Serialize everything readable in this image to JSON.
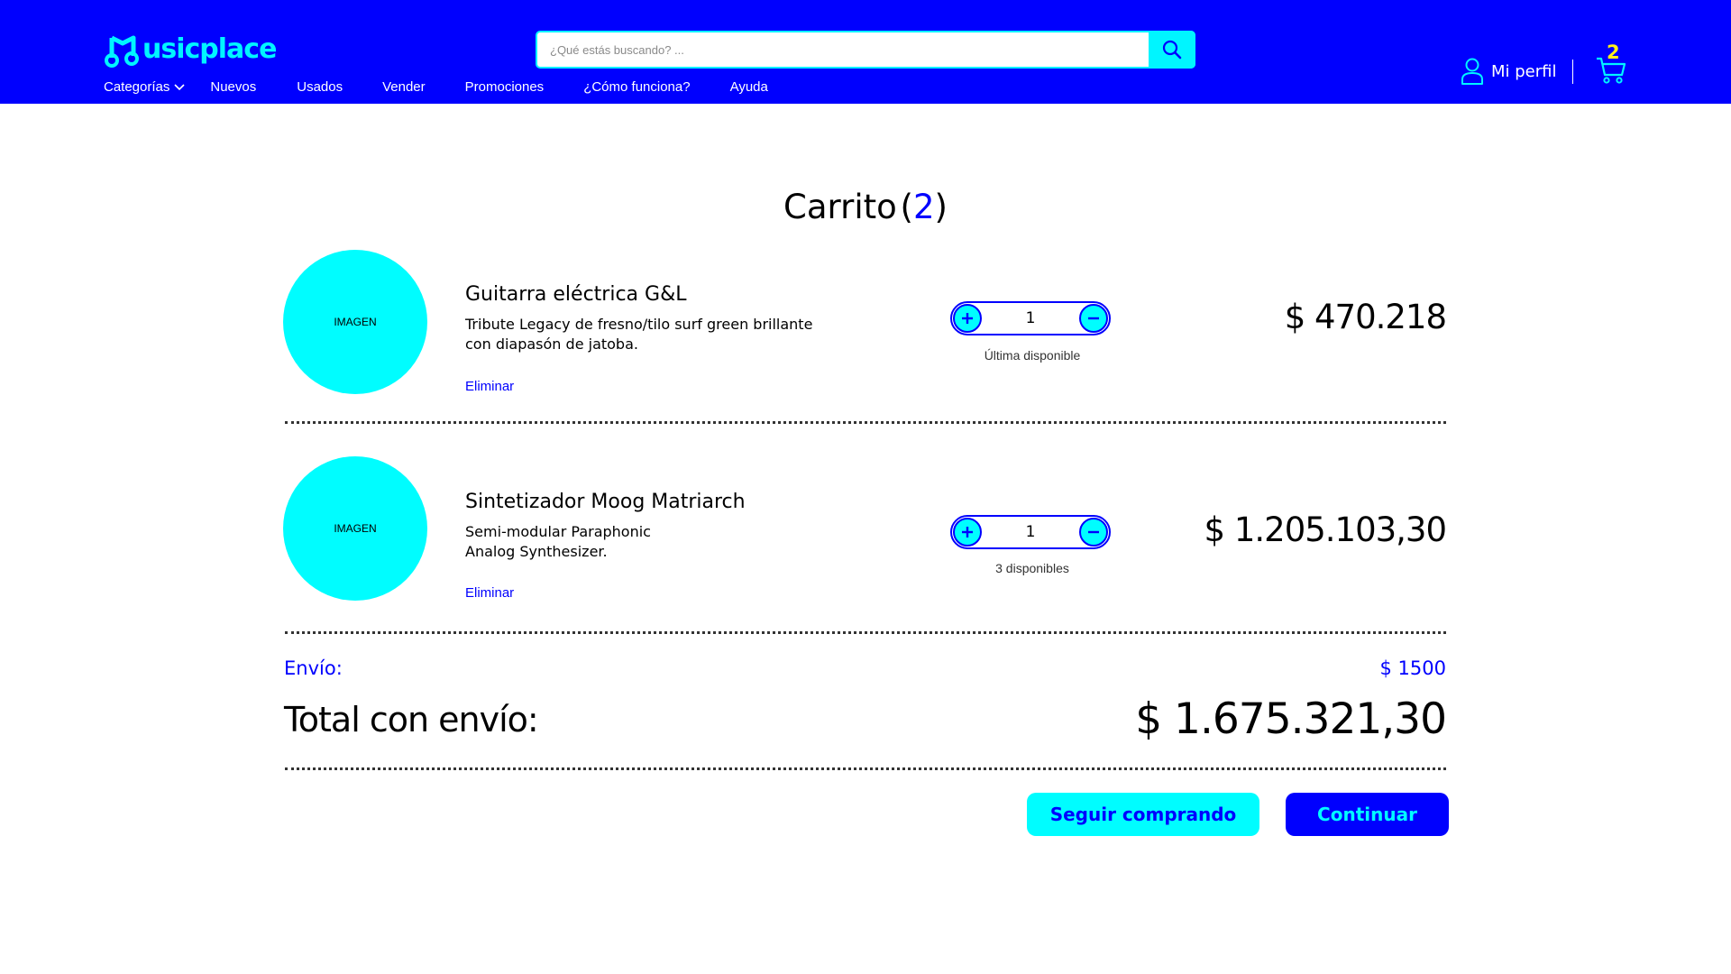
{
  "header": {
    "logo_text": "usicplace",
    "search": {
      "placeholder": "¿Qué estás buscando? ..."
    },
    "nav": [
      {
        "label": "Categorías"
      },
      {
        "label": "Nuevos"
      },
      {
        "label": "Usados"
      },
      {
        "label": "Vender"
      },
      {
        "label": "Promociones"
      },
      {
        "label": "¿Cómo funciona?"
      },
      {
        "label": "Ayuda"
      }
    ],
    "profile_label": "Mi perfil",
    "cart_count": "2"
  },
  "cart": {
    "title": "Carrito",
    "title_open": "(",
    "title_count": "2",
    "title_close": ")",
    "items": [
      {
        "image_label": "IMAGEN",
        "name": "Guitarra eléctrica G&L",
        "description": "Tribute Legacy de fresno/tilo surf green brillante con diapasón de jatoba.",
        "remove_label": "Eliminar",
        "quantity": "1",
        "availability": "Última disponible",
        "price": "$ 470.218"
      },
      {
        "image_label": "IMAGEN",
        "name": "Sintetizador Moog Matriarch",
        "description_lines": [
          "Semi-modular Paraphonic",
          "Analog Synthesizer."
        ],
        "remove_label": "Eliminar",
        "quantity": "1",
        "availability": "3 disponibles",
        "price": "$ 1.205.103,30"
      }
    ],
    "shipping_label": "Envío:",
    "shipping_value": "$ 1500",
    "total_label": "Total con envío:",
    "total_value": "$ 1.675.321,30",
    "continue_shopping_label": "Seguir comprando",
    "continue_label": "Continuar"
  },
  "colors": {
    "brand_blue": "#0000fe",
    "accent_cyan": "#00fdff",
    "badge_yellow": "#fff21a"
  }
}
